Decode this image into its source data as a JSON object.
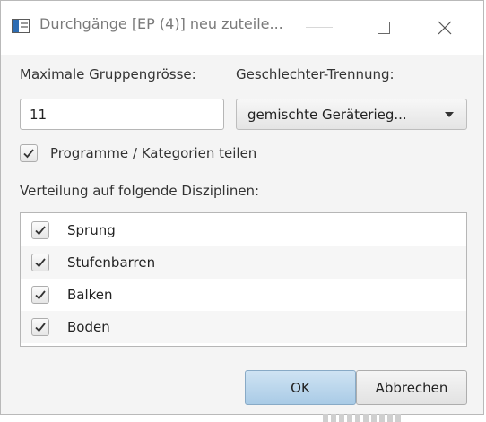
{
  "window": {
    "title": "Durchgänge [EP (4)] neu zuteile..."
  },
  "form": {
    "max_group_label": "Maximale Gruppengrösse:",
    "max_group_value": "11",
    "gender_label": "Geschlechter-Trennung:",
    "gender_selected": "gemischte Geräterieg...",
    "split_programs_label": "Programme / Kategorien teilen",
    "split_programs_checked": true,
    "disciplines_label": "Verteilung auf folgende Disziplinen:"
  },
  "disciplines": [
    {
      "label": "Sprung",
      "checked": true
    },
    {
      "label": "Stufenbarren",
      "checked": true
    },
    {
      "label": "Balken",
      "checked": true
    },
    {
      "label": "Boden",
      "checked": true
    }
  ],
  "buttons": {
    "ok": "OK",
    "cancel": "Abbrechen"
  },
  "colors": {
    "ok_button": "#b8d6ee",
    "app_icon": "#2e6db3"
  }
}
